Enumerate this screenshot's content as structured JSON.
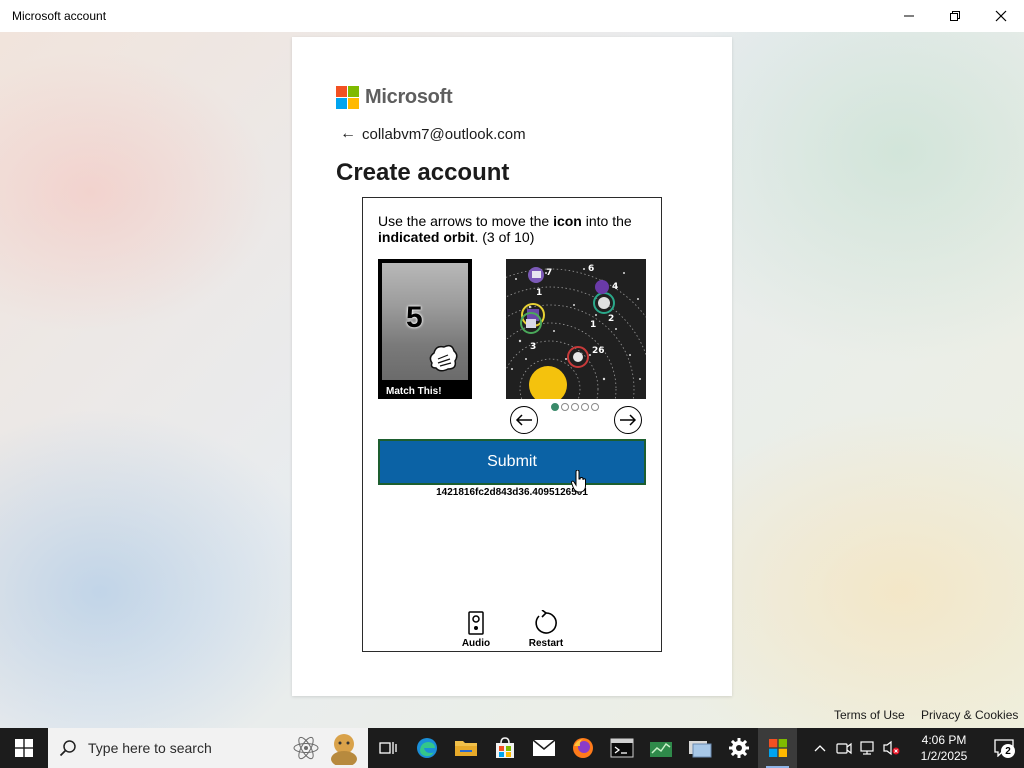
{
  "window": {
    "title": "Microsoft account"
  },
  "card": {
    "brand": "Microsoft",
    "email": "collabvm7@outlook.com",
    "heading": "Create account",
    "brand_colors": [
      "#f25022",
      "#7fba00",
      "#00a4ef",
      "#ffb900"
    ]
  },
  "captcha": {
    "instruction_part1": "Use the arrows to move the ",
    "instruction_bold1": "icon",
    "instruction_part2": " into the ",
    "instruction_bold2": "indicated orbit",
    "instruction_part3": ". (3 of 10)",
    "target_number": "5",
    "target_caption": "Match This!",
    "orbit_labels": [
      "7",
      "1",
      "6",
      "4",
      "2",
      "1",
      "26",
      "3"
    ],
    "page_count": 5,
    "active_page": 1,
    "submit_label": "Submit",
    "session_id": "1421816fc2d843d36.4095126501",
    "audio_label": "Audio",
    "restart_label": "Restart"
  },
  "footer": {
    "terms": "Terms of Use",
    "privacy": "Privacy & Cookies"
  },
  "taskbar": {
    "search_placeholder": "Type here to search",
    "time": "4:06 PM",
    "date": "1/2/2025",
    "notification_count": "2"
  }
}
